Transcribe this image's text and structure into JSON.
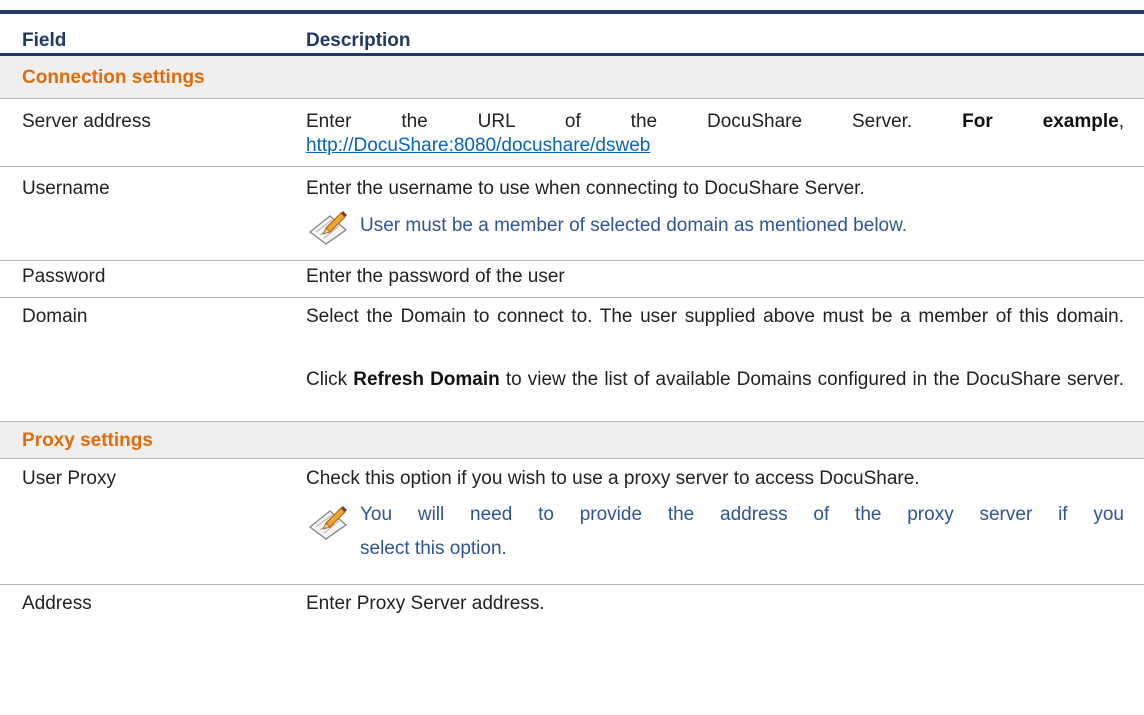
{
  "header": {
    "field": "Field",
    "description": "Description"
  },
  "sections": {
    "connection": "Connection settings",
    "proxy": "Proxy settings"
  },
  "rows": {
    "server_address": {
      "field": "Server address",
      "desc_pre": "Enter the URL of the DocuShare Server.",
      "desc_bold": "For example",
      "desc_comma": ",",
      "link": "http://DocuShare:8080/docushare/dsweb"
    },
    "username": {
      "field": "Username",
      "desc": "Enter the username to use when connecting to DocuShare Server.",
      "note": "User must be a member of selected domain as mentioned below."
    },
    "password": {
      "field": "Password",
      "desc": "Enter the password of the user"
    },
    "domain": {
      "field": "Domain",
      "desc1": "Select the Domain to connect to. The user supplied above must be a member of this domain.",
      "desc2_pre": "Click",
      "desc2_bold": "Refresh Domain",
      "desc2_post": "to view the list of available Domains configured in the DocuShare server."
    },
    "user_proxy": {
      "field": "User Proxy",
      "desc": "Check this option if you wish to use a proxy server to access DocuShare.",
      "note_line1": "You will need to provide the address of the proxy server if you",
      "note_line2": "select this option."
    },
    "address": {
      "field": "Address",
      "desc": "Enter Proxy Server address."
    }
  },
  "icons": {
    "note": "notepad-pencil-icon"
  },
  "colors": {
    "header_text": "#1f3864",
    "section_text": "#e26b0a",
    "link": "#0563c1",
    "note_text": "#2e5597",
    "section_bg": "#efefef"
  }
}
